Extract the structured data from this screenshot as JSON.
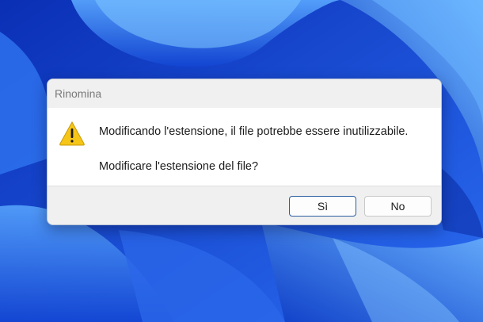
{
  "dialog": {
    "title": "Rinomina",
    "message_line1": "Modificando l'estensione, il file potrebbe essere inutilizzabile.",
    "message_line2": "Modificare l'estensione del file?",
    "icon": "warning-icon",
    "buttons": {
      "yes_label": "Sì",
      "no_label": "No"
    }
  },
  "colors": {
    "wallpaper_blue": "#1a4fd8",
    "dialog_bg": "#ffffff",
    "titlebar_bg": "#f0f0f0",
    "warning_yellow": "#f5c518",
    "default_button_border": "#2b5d9e"
  }
}
